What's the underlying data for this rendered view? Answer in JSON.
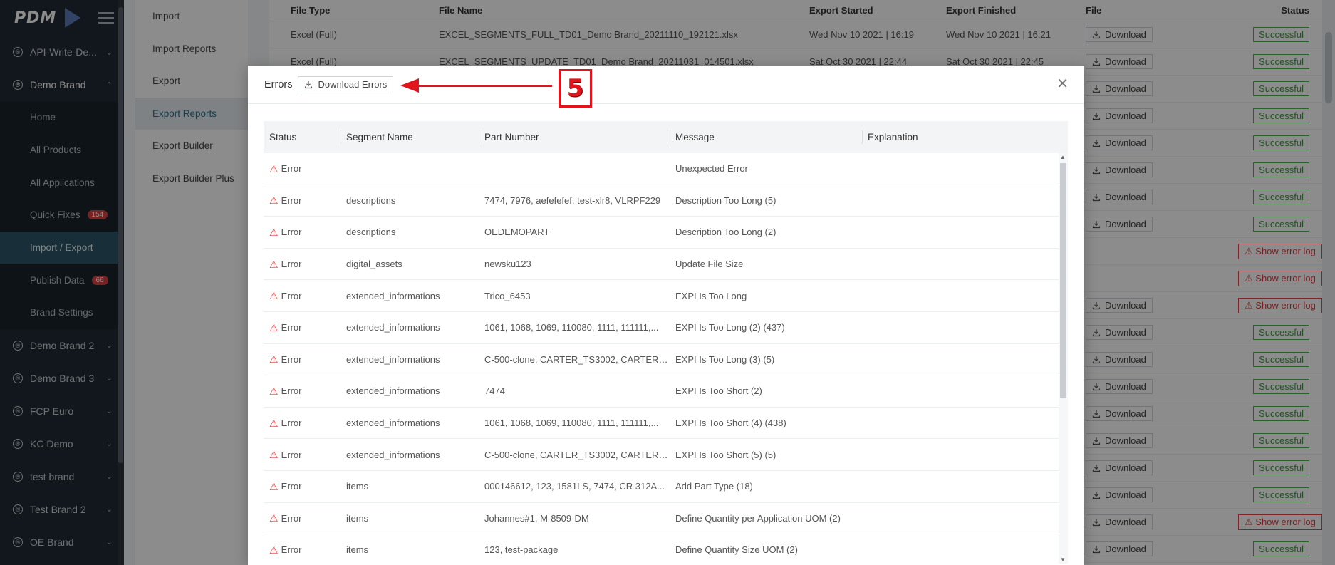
{
  "sidebar": {
    "logo": "PDM",
    "brands": [
      {
        "label": "API-Write-De...",
        "open": false
      },
      {
        "label": "Demo Brand",
        "open": true
      }
    ],
    "sub_items": [
      {
        "label": "Home"
      },
      {
        "label": "All Products"
      },
      {
        "label": "All Applications"
      },
      {
        "label": "Quick Fixes",
        "badge": "154"
      },
      {
        "label": "Import / Export",
        "active": true
      },
      {
        "label": "Publish Data",
        "badge": "66"
      },
      {
        "label": "Brand Settings"
      }
    ],
    "more_brands": [
      {
        "label": "Demo Brand 2"
      },
      {
        "label": "Demo Brand 3"
      },
      {
        "label": "FCP Euro"
      },
      {
        "label": "KC Demo"
      },
      {
        "label": "test brand"
      },
      {
        "label": "Test Brand 2"
      },
      {
        "label": "OE Brand"
      }
    ]
  },
  "subnav": {
    "items": [
      {
        "label": "Import"
      },
      {
        "label": "Import Reports"
      },
      {
        "label": "Export"
      },
      {
        "label": "Export Reports",
        "active": true
      },
      {
        "label": "Export Builder"
      },
      {
        "label": "Export Builder Plus"
      }
    ]
  },
  "background_table": {
    "headers": {
      "file_type": "File Type",
      "file_name": "File Name",
      "export_started": "Export Started",
      "export_finished": "Export Finished",
      "file": "File",
      "status": "Status"
    },
    "rows": [
      {
        "type": "Excel (Full)",
        "name": "EXCEL_SEGMENTS_FULL_TD01_Demo Brand_20211110_192121.xlsx",
        "started": "Wed Nov 10 2021 | 16:19",
        "finished": "Wed Nov 10 2021 | 16:21",
        "download": true,
        "status": "Successful"
      },
      {
        "type": "Excel (Full)",
        "name": "EXCEL_SEGMENTS_UPDATE_TD01_Demo Brand_20211031_014501.xlsx",
        "started": "Sat Oct 30 2021 | 22:44",
        "finished": "Sat Oct 30 2021 | 22:45",
        "download": true,
        "status": "Successful"
      },
      {
        "type": "",
        "name": "",
        "started": "",
        "finished": "",
        "download": true,
        "status": "Successful"
      },
      {
        "type": "",
        "name": "",
        "started": "",
        "finished": "",
        "download": true,
        "status": "Successful"
      },
      {
        "type": "",
        "name": "",
        "started": "",
        "finished": "",
        "download": true,
        "status": "Successful"
      },
      {
        "type": "",
        "name": "",
        "started": "",
        "finished": "",
        "download": true,
        "status": "Successful"
      },
      {
        "type": "",
        "name": "",
        "started": "",
        "finished": "",
        "download": true,
        "status": "Successful"
      },
      {
        "type": "",
        "name": "",
        "started": "",
        "finished": "",
        "download": true,
        "status": "Successful"
      },
      {
        "type": "",
        "name": "",
        "started": "",
        "finished": "",
        "download": false,
        "status": "Show error log"
      },
      {
        "type": "",
        "name": "",
        "started": "",
        "finished": "",
        "download": false,
        "status": "Show error log"
      },
      {
        "type": "",
        "name": "",
        "started": "",
        "finished": "",
        "download": true,
        "status": "Show error log"
      },
      {
        "type": "",
        "name": "",
        "started": "",
        "finished": "",
        "download": true,
        "status": "Successful"
      },
      {
        "type": "",
        "name": "",
        "started": "",
        "finished": "",
        "download": true,
        "status": "Successful"
      },
      {
        "type": "",
        "name": "",
        "started": "",
        "finished": "",
        "download": true,
        "status": "Successful"
      },
      {
        "type": "",
        "name": "",
        "started": "",
        "finished": "",
        "download": true,
        "status": "Successful"
      },
      {
        "type": "",
        "name": "",
        "started": "",
        "finished": "",
        "download": true,
        "status": "Successful"
      },
      {
        "type": "",
        "name": "",
        "started": "",
        "finished": "",
        "download": true,
        "status": "Successful"
      },
      {
        "type": "",
        "name": "",
        "started": "",
        "finished": "",
        "download": true,
        "status": "Successful"
      },
      {
        "type": "",
        "name": "",
        "started": "",
        "finished": "",
        "download": true,
        "status": "Show error log"
      },
      {
        "type": "",
        "name": "",
        "started": "",
        "finished": "",
        "download": true,
        "status": "Successful"
      }
    ],
    "download_label": "Download"
  },
  "modal": {
    "title": "Errors",
    "download_errors_label": "Download Errors",
    "close_icon": "close-icon",
    "columns": {
      "status": "Status",
      "segment": "Segment Name",
      "part": "Part Number",
      "message": "Message",
      "explanation": "Explanation"
    },
    "rows": [
      {
        "status": "Error",
        "segment": "",
        "part": "",
        "message": "Unexpected Error",
        "explanation": ""
      },
      {
        "status": "Error",
        "segment": "descriptions",
        "part": "7474, 7976, aefefefef, test-xlr8, VLRPF229",
        "message": "Description Too Long (5)",
        "explanation": ""
      },
      {
        "status": "Error",
        "segment": "descriptions",
        "part": "OEDEMOPART",
        "message": "Description Too Long (2)",
        "explanation": ""
      },
      {
        "status": "Error",
        "segment": "digital_assets",
        "part": "newsku123",
        "message": "Update File Size",
        "explanation": ""
      },
      {
        "status": "Error",
        "segment": "extended_informations",
        "part": "Trico_6453",
        "message": "EXPI Is Too Long",
        "explanation": ""
      },
      {
        "status": "Error",
        "segment": "extended_informations",
        "part": "1061, 1068, 1069, 110080, 1111, 111111,...",
        "message": "EXPI Is Too Long (2) (437)",
        "explanation": ""
      },
      {
        "status": "Error",
        "segment": "extended_informations",
        "part": "C-500-clone, CARTER_TS3002, CARTER_...",
        "message": "EXPI Is Too Long (3) (5)",
        "explanation": ""
      },
      {
        "status": "Error",
        "segment": "extended_informations",
        "part": "7474",
        "message": "EXPI Is Too Short (2)",
        "explanation": ""
      },
      {
        "status": "Error",
        "segment": "extended_informations",
        "part": "1061, 1068, 1069, 110080, 1111, 111111,...",
        "message": "EXPI Is Too Short (4) (438)",
        "explanation": ""
      },
      {
        "status": "Error",
        "segment": "extended_informations",
        "part": "C-500-clone, CARTER_TS3002, CARTER_...",
        "message": "EXPI Is Too Short (5) (5)",
        "explanation": ""
      },
      {
        "status": "Error",
        "segment": "items",
        "part": "000146612, 123, 1581LS, 7474, CR 312A...",
        "message": "Add Part Type (18)",
        "explanation": ""
      },
      {
        "status": "Error",
        "segment": "items",
        "part": "Johannes#1, M-8509-DM",
        "message": "Define Quantity per Application UOM (2)",
        "explanation": ""
      },
      {
        "status": "Error",
        "segment": "items",
        "part": "123, test-package",
        "message": "Define Quantity Size UOM (2)",
        "explanation": ""
      }
    ]
  },
  "annotation": {
    "number": "5",
    "color": "#e0141c"
  },
  "colors": {
    "sidebar_bg": "#1f2a33",
    "active_teal": "#2c5566",
    "success": "#4caf50",
    "error": "#e04848"
  }
}
